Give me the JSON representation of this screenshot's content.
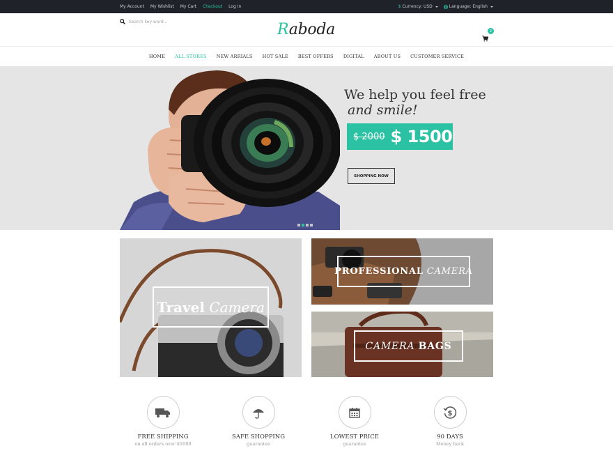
{
  "topbar": {
    "links": [
      {
        "label": "My Account",
        "active": false
      },
      {
        "label": "My Wishlist",
        "active": false
      },
      {
        "label": "My Cart",
        "active": false
      },
      {
        "label": "Checkout",
        "active": true
      },
      {
        "label": "Log In",
        "active": false
      }
    ],
    "currency": {
      "prefix": "$",
      "label": "Currency: USD"
    },
    "language": {
      "label": "Language: English"
    }
  },
  "header": {
    "search_placeholder": "Search key word...",
    "logo_initial": "R",
    "logo_rest": "aboda",
    "cart_count": "2"
  },
  "nav": {
    "items": [
      {
        "label": "HOME",
        "active": false
      },
      {
        "label": "ALL STORES",
        "active": true
      },
      {
        "label": "NEW ARRIALS",
        "active": false
      },
      {
        "label": "HOT SALE",
        "active": false
      },
      {
        "label": "BEST OFFERS",
        "active": false
      },
      {
        "label": "DIGITAL",
        "active": false
      },
      {
        "label": "ABOUT US",
        "active": false
      },
      {
        "label": "CUSTOMER SERVICE",
        "active": false
      }
    ]
  },
  "hero": {
    "title": "We help you feel free",
    "subtitle": "and smile!",
    "old_price": "$ 2000",
    "new_price": "$ 1500",
    "button": "SHOPPING NOW",
    "slides": 4,
    "active_slide": 2
  },
  "categories": [
    {
      "bold": "Travel",
      "italic": "Camera"
    },
    {
      "bold": "PROFESSIONAL",
      "italic": "CAMERA"
    },
    {
      "italic": "CAMERA",
      "bold": "BAGS"
    }
  ],
  "features": [
    {
      "icon": "truck-icon",
      "title": "FREE SHIPPING",
      "sub": "on all orders over $1000"
    },
    {
      "icon": "umbrella-icon",
      "title": "SAFE SHOPPING",
      "sub": "guarantee"
    },
    {
      "icon": "calendar-icon",
      "title": "LOWEST PRICE",
      "sub": "guarantee"
    },
    {
      "icon": "money-back-icon",
      "title": "90 DAYS",
      "sub": "Money back"
    }
  ],
  "colors": {
    "accent": "#2bc1a3",
    "topbar": "#1f2229",
    "hero_bg": "#e5e5e5"
  }
}
